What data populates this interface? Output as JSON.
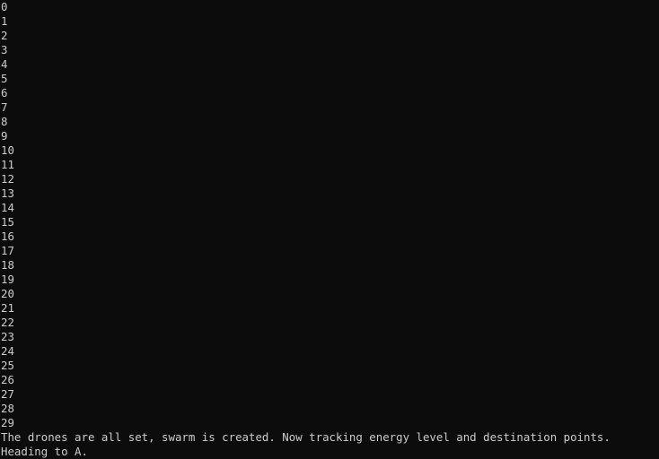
{
  "console": {
    "lines": [
      "0",
      "1",
      "2",
      "3",
      "4",
      "5",
      "6",
      "7",
      "8",
      "9",
      "10",
      "11",
      "12",
      "13",
      "14",
      "15",
      "16",
      "17",
      "18",
      "19",
      "20",
      "21",
      "22",
      "23",
      "24",
      "25",
      "26",
      "27",
      "28",
      "29",
      "The drones are all set, swarm is created. Now tracking energy level and destination points.",
      "Heading to A."
    ],
    "colors": {
      "background": "#0c0c0c",
      "text": "#cccccc"
    }
  }
}
